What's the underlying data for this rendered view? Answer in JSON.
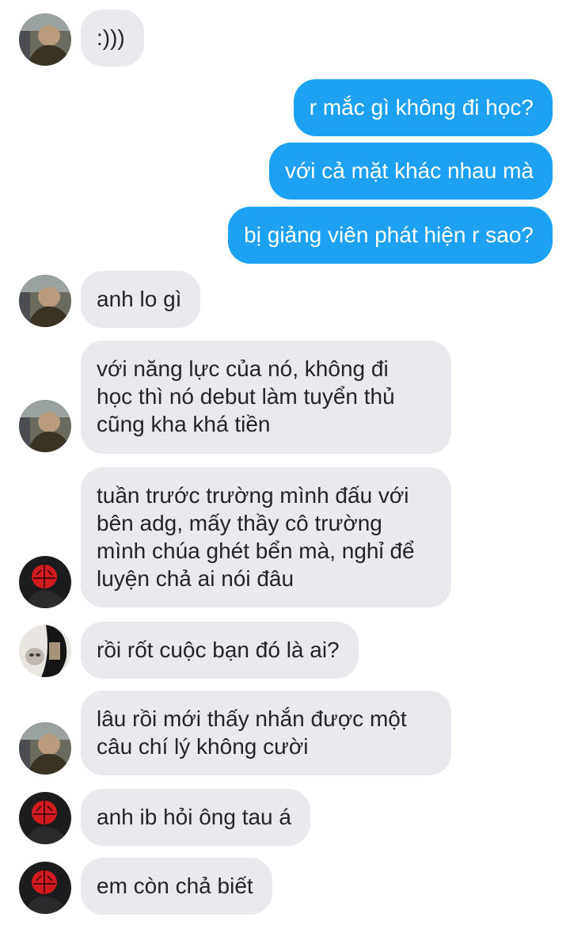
{
  "messages": [
    {
      "side": "in",
      "avatar": "user-a",
      "text": ":)))"
    },
    {
      "side": "out",
      "text": "r mắc gì không đi học?"
    },
    {
      "side": "out",
      "text": "với cả mặt khác nhau mà"
    },
    {
      "side": "out",
      "text": "bị giảng viên phát hiện r sao?"
    },
    {
      "side": "in",
      "avatar": "user-a",
      "text": "anh lo gì"
    },
    {
      "side": "in",
      "avatar": "user-a",
      "lines": [
        "với năng lực của nó, không đi",
        "học thì nó debut làm tuyển thủ",
        "cũng kha khá tiền"
      ]
    },
    {
      "side": "in",
      "avatar": "user-b",
      "lines": [
        "tuần trước trường mình đấu với",
        "bên adg, mấy thầy cô trường",
        "mình chúa ghét bển mà, nghỉ để",
        "luyện chả ai nói đâu"
      ]
    },
    {
      "side": "in",
      "avatar": "user-c",
      "text": "rồi rốt cuộc bạn đó là ai?"
    },
    {
      "side": "in",
      "avatar": "user-a",
      "lines": [
        "lâu rồi mới thấy nhắn được một",
        "câu chí lý không cười"
      ]
    },
    {
      "side": "in",
      "avatar": "user-b",
      "text": "anh ib hỏi ông tau á"
    },
    {
      "side": "in",
      "avatar": "user-b",
      "text": "em còn chả biết"
    }
  ],
  "colors": {
    "incoming_bubble": "#e8eaee",
    "outgoing_bubble": "#1da1f2",
    "incoming_text": "#222426",
    "outgoing_text": "#ffffff"
  }
}
